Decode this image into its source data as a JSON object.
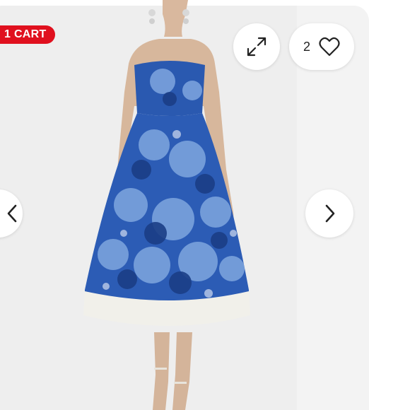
{
  "badge": {
    "text": "1 CART",
    "color": "#e0101e"
  },
  "favorite": {
    "count": "2",
    "icon": "heart-outline-icon"
  },
  "controls": {
    "expand_icon": "expand-arrows-icon",
    "next_icon": "chevron-right-icon",
    "prev_icon": "chevron-left-icon"
  },
  "colors": {
    "card_bg": "#eeeeee",
    "dress_blue": "#2a59b0",
    "dress_ivory": "#f1f0ea"
  }
}
